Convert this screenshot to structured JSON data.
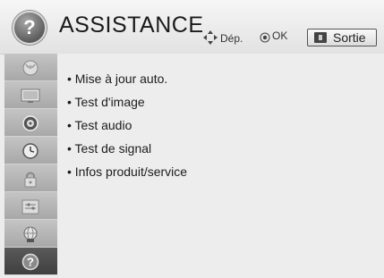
{
  "header": {
    "help_glyph": "?",
    "title": "ASSISTANCE",
    "hint_move": "Dép.",
    "hint_ok": "OK",
    "exit_label": "Sortie"
  },
  "sidebar": {
    "items": [
      {
        "icon": "satellite-dish-icon",
        "active": false
      },
      {
        "icon": "tv-picture-icon",
        "active": false
      },
      {
        "icon": "speaker-icon",
        "active": false
      },
      {
        "icon": "clock-icon",
        "active": false
      },
      {
        "icon": "lock-icon",
        "active": false
      },
      {
        "icon": "settings-box-icon",
        "active": false
      },
      {
        "icon": "network-globe-icon",
        "active": false
      },
      {
        "icon": "help-icon",
        "active": true,
        "glyph": "?"
      }
    ]
  },
  "menu": {
    "items": [
      {
        "label": "• Mise à jour auto."
      },
      {
        "label": "• Test d'image"
      },
      {
        "label": "• Test audio"
      },
      {
        "label": "• Test de signal"
      },
      {
        "label": "• Infos produit/service"
      }
    ]
  },
  "colors": {
    "sidebar_bg": "#b5b5b5",
    "sidebar_active": "#4a4a4a",
    "main_bg": "#ededed"
  }
}
